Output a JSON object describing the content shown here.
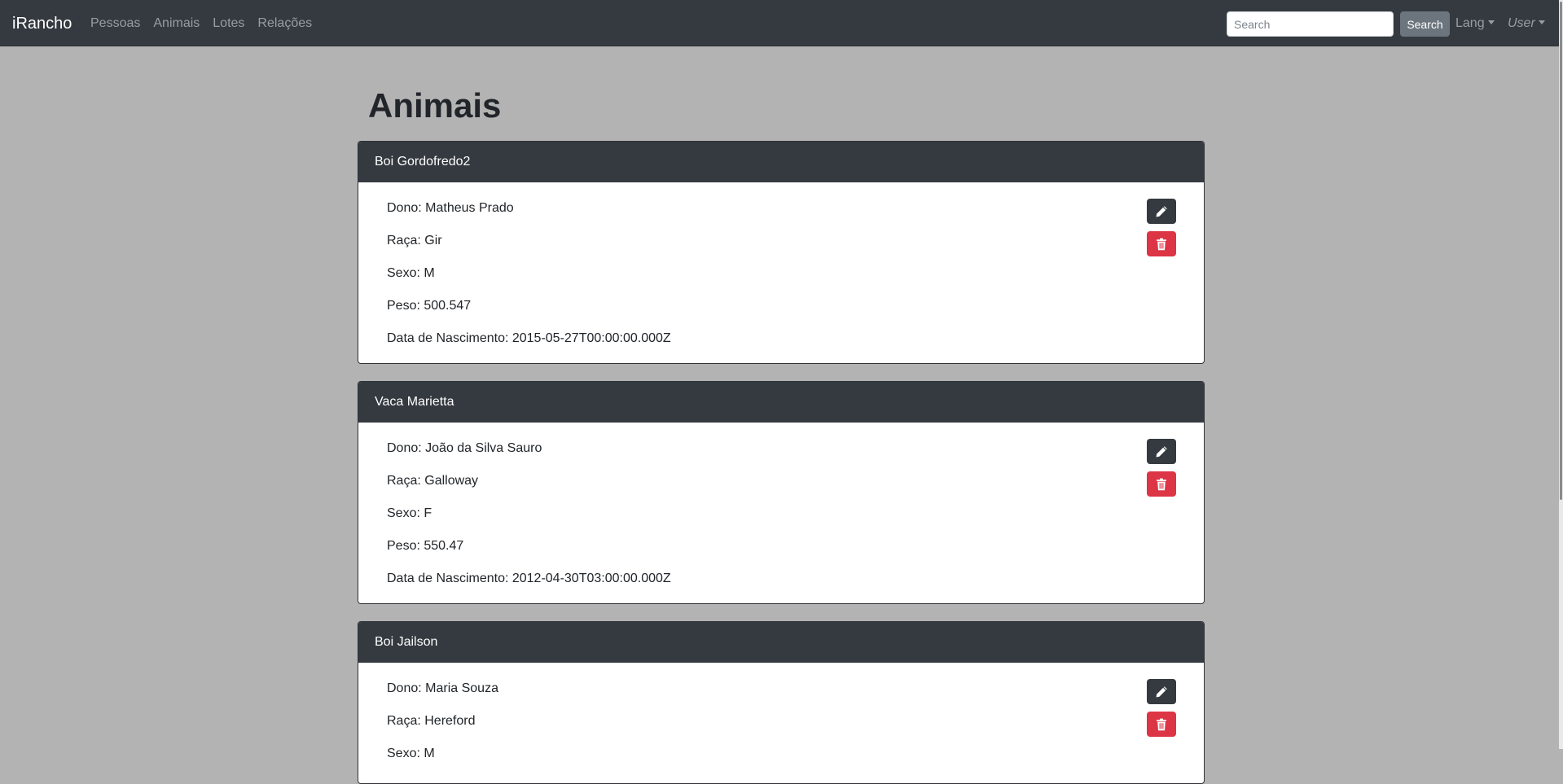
{
  "navbar": {
    "brand": "iRancho",
    "links": [
      "Pessoas",
      "Animais",
      "Lotes",
      "Relações"
    ],
    "search_placeholder": "Search",
    "search_button": "Search",
    "lang_label": "Lang",
    "user_label": "User"
  },
  "page": {
    "title": "Animais"
  },
  "animals": [
    {
      "name": "Boi Gordofredo2",
      "owner_line": "Dono: Matheus Prado",
      "breed_line": "Raça: Gir",
      "sex_line": "Sexo: M",
      "weight_line": "Peso: 500.547",
      "birth_line": "Data de Nascimento: 2015-05-27T00:00:00.000Z"
    },
    {
      "name": "Vaca Marietta",
      "owner_line": "Dono: João da Silva Sauro",
      "breed_line": "Raça: Galloway",
      "sex_line": "Sexo: F",
      "weight_line": "Peso: 550.47",
      "birth_line": "Data de Nascimento: 2012-04-30T03:00:00.000Z"
    },
    {
      "name": "Boi Jailson",
      "owner_line": "Dono: Maria Souza",
      "breed_line": "Raça: Hereford",
      "sex_line": "Sexo: M",
      "weight_line": "",
      "birth_line": ""
    }
  ],
  "icons": {
    "edit": "pencil-icon",
    "delete": "trash-icon"
  },
  "colors": {
    "navbar_bg": "#343a40",
    "card_header_bg": "#343a40",
    "delete_button": "#dc3545",
    "edit_button": "#343a40",
    "page_bg": "#b3b3b3"
  }
}
